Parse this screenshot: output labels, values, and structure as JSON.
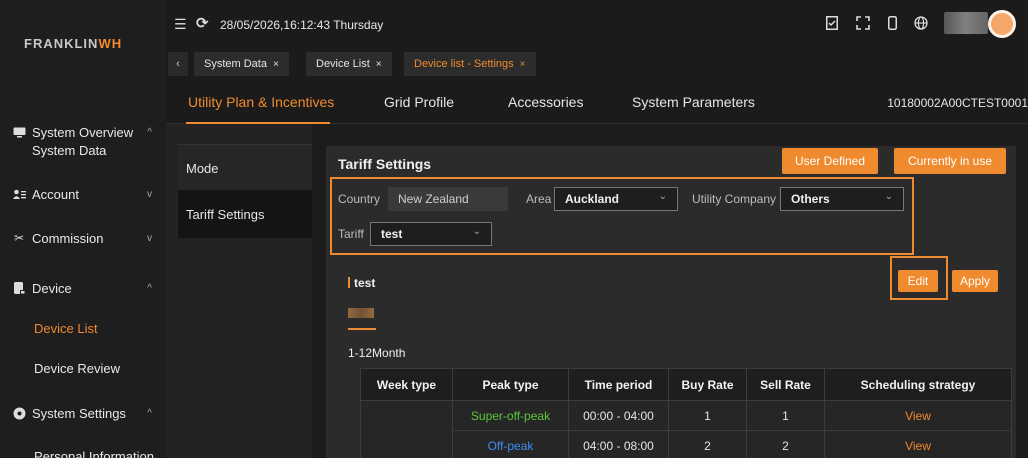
{
  "brand": {
    "name_a": "FRANKLIN",
    "name_b": "WH"
  },
  "topbar": {
    "datetime": "28/05/2026,16:12:43 Thursday"
  },
  "tabs": [
    {
      "label": "System Data"
    },
    {
      "label": "Device List"
    },
    {
      "label": "Device list - Settings"
    }
  ],
  "sidebar": {
    "items": [
      {
        "label": "System Overview",
        "icon": "monitor-icon"
      },
      {
        "label": "System Data"
      },
      {
        "label": "Account",
        "icon": "account-icon"
      },
      {
        "label": "Commission",
        "icon": "tools-icon"
      },
      {
        "label": "Device",
        "icon": "device-icon"
      },
      {
        "label": "Device List"
      },
      {
        "label": "Device Review"
      },
      {
        "label": "System Settings",
        "icon": "gear-icon"
      },
      {
        "label": "Personal Information"
      }
    ]
  },
  "subnav": {
    "items": [
      "Utility Plan & Incentives",
      "Grid Profile",
      "Accessories",
      "System Parameters"
    ],
    "serial": "10180002A00CTEST0001"
  },
  "modes": [
    "Mode",
    "Tariff Settings"
  ],
  "tariff": {
    "title": "Tariff Settings",
    "user_defined": "User Defined",
    "in_use": "Currently in use",
    "country_label": "Country",
    "country_value": "New Zealand",
    "area_label": "Area",
    "area_value": "Auckland",
    "utility_label": "Utility Company",
    "utility_value": "Others",
    "tariff_label": "Tariff",
    "tariff_value": "test",
    "name": "test",
    "edit": "Edit",
    "apply": "Apply",
    "month_range": "1-12Month"
  },
  "table": {
    "headers": [
      "Week type",
      "Peak type",
      "Time period",
      "Buy Rate",
      "Sell Rate",
      "Scheduling strategy"
    ],
    "rows": [
      {
        "week": "",
        "peak": "Super-off-peak",
        "period": "00:00 - 04:00",
        "buy": "1",
        "sell": "1",
        "strategy": "View"
      },
      {
        "week": "",
        "peak": "Off-peak",
        "period": "04:00 - 08:00",
        "buy": "2",
        "sell": "2",
        "strategy": "View"
      }
    ]
  },
  "colors": {
    "accent": "#f08a2e",
    "super_off_peak": "#5cc63a",
    "off_peak": "#3d8ef0"
  }
}
